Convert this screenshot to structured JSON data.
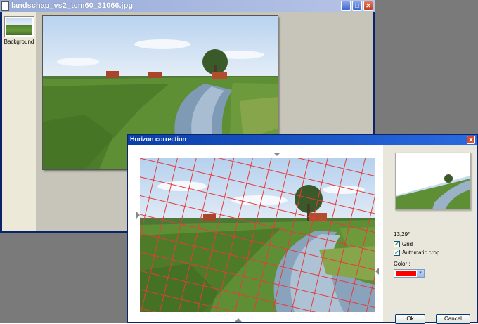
{
  "editor": {
    "title": "landschap_vs2_tcm60_31066.jpg",
    "layer_label": "Background",
    "window_buttons": {
      "minimize": "_",
      "maximize": "□",
      "close": "✕"
    }
  },
  "dialog": {
    "title": "Horizon correction",
    "close_glyph": "✕",
    "angle": "13,29°",
    "grid_label": "Grid",
    "grid_checked": true,
    "autocrop_label": "Automatic crop",
    "autocrop_checked": true,
    "color_label": "Color :",
    "grid_color": "#ff0000",
    "ok_label": "Ok",
    "cancel_label": "Cancel",
    "check_glyph": "✓",
    "dropdown_glyph": "▾"
  },
  "colors": {
    "desktop": "#7a7a7a",
    "dialog_titlebar": "#0a3fa8",
    "editor_titlebar_inactive": "#98abd8"
  },
  "icons": [
    "app-icon",
    "minimize-icon",
    "maximize-icon",
    "close-icon",
    "checkbox-check-icon",
    "dropdown-arrow-icon",
    "handle-arrow-icon"
  ]
}
